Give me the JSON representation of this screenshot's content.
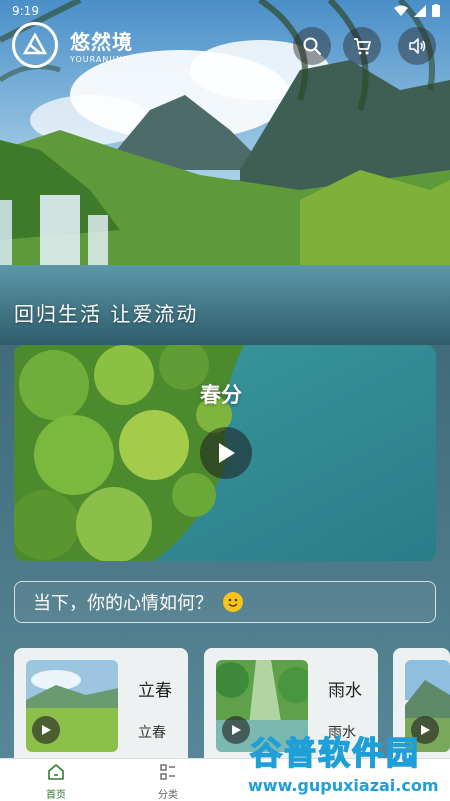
{
  "status_bar": {
    "time": "9:19"
  },
  "header": {
    "brand_name": "悠然境",
    "brand_en": "YOURANJING"
  },
  "icons": {
    "search": "search-icon",
    "cart": "cart-icon",
    "sound": "speaker-icon",
    "play": "play-icon",
    "emoji": "smile-emoji"
  },
  "hero": {
    "slogan": "回归生活 让爱流动"
  },
  "featured_video": {
    "title": "春分"
  },
  "mood_prompt": {
    "text": "当下，你的心情如何？"
  },
  "cards": [
    {
      "title": "立春",
      "subtitle": "立春"
    },
    {
      "title": "雨水",
      "subtitle": "雨水"
    },
    {
      "title": "",
      "subtitle": ""
    }
  ],
  "tabbar": {
    "items": [
      {
        "label": "首页",
        "active": true
      },
      {
        "label": "分类",
        "active": false
      }
    ]
  },
  "watermark": {
    "title": "谷普软件园",
    "url": "www.gupuxiazai.com"
  },
  "colors": {
    "accent": "#2e7d32",
    "watermark_blue": "#1f9fd8"
  }
}
